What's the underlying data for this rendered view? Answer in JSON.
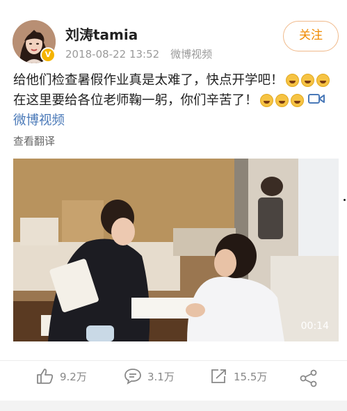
{
  "user": {
    "name": "刘涛tamia",
    "date": "2018-08-22 13:52",
    "source": "微博视频",
    "verified_badge": "V"
  },
  "follow_label": "关注",
  "post": {
    "line1": "给他们检查暑假作业真是太难了，快点开学吧！",
    "line2": "在这里要给各位老师鞠一躬，你们辛苦了！",
    "video_link": "微博视频",
    "icons": [
      "laughing-tears-emoji",
      "video-camera-icon"
    ]
  },
  "translate_label": "查看翻译",
  "video": {
    "duration": "00:14"
  },
  "actions": {
    "likes": "9.2万",
    "comments": "3.1万",
    "reposts": "15.5万"
  },
  "colors": {
    "accent_orange": "#f08a00",
    "link_blue": "#4a79b8",
    "badge_gold": "#f5b400"
  }
}
